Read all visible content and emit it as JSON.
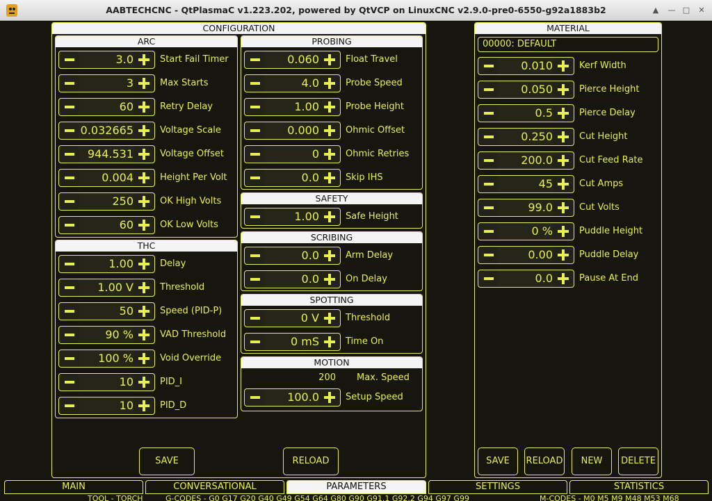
{
  "window": {
    "title": "AABTECHCNC - QtPlasmaC v1.223.202, powered by QtVCP on LinuxCNC v2.9.0-pre0-6550-g92a1883b2"
  },
  "window_buttons": {
    "up": "▲",
    "min": "—",
    "max": "□",
    "close": "✕"
  },
  "configuration": {
    "title": "CONFIGURATION",
    "arc": {
      "title": "ARC",
      "rows": [
        {
          "value": "3.0",
          "label": "Start Fail Timer"
        },
        {
          "value": "3",
          "label": "Max Starts"
        },
        {
          "value": "60",
          "label": "Retry Delay"
        },
        {
          "value": "0.032665",
          "label": "Voltage Scale"
        },
        {
          "value": "944.531",
          "label": "Voltage Offset"
        },
        {
          "value": "0.004",
          "label": "Height Per Volt"
        },
        {
          "value": "250",
          "label": "OK High Volts"
        },
        {
          "value": "60",
          "label": "OK Low Volts"
        }
      ]
    },
    "thc": {
      "title": "THC",
      "rows": [
        {
          "value": "1.00",
          "label": "Delay"
        },
        {
          "value": "1.00 V",
          "label": "Threshold"
        },
        {
          "value": "50",
          "label": "Speed (PID-P)"
        },
        {
          "value": "90 %",
          "label": "VAD Threshold"
        },
        {
          "value": "100 %",
          "label": "Void Override"
        },
        {
          "value": "10",
          "label": "PID_I"
        },
        {
          "value": "10",
          "label": "PID_D"
        }
      ]
    },
    "probing": {
      "title": "PROBING",
      "rows": [
        {
          "value": "0.060",
          "label": "Float Travel"
        },
        {
          "value": "4.0",
          "label": "Probe Speed"
        },
        {
          "value": "1.00",
          "label": "Probe Height"
        },
        {
          "value": "0.000",
          "label": "Ohmic Offset"
        },
        {
          "value": "0",
          "label": "Ohmic Retries"
        },
        {
          "value": "0.0",
          "label": "Skip IHS"
        }
      ]
    },
    "safety": {
      "title": "SAFETY",
      "rows": [
        {
          "value": "1.00",
          "label": "Safe Height"
        }
      ]
    },
    "scribing": {
      "title": "SCRIBING",
      "rows": [
        {
          "value": "0.0",
          "label": "Arm Delay"
        },
        {
          "value": "0.0",
          "label": "On Delay"
        }
      ]
    },
    "spotting": {
      "title": "SPOTTING",
      "rows": [
        {
          "value": "0 V",
          "label": "Threshold"
        },
        {
          "value": "0 mS",
          "label": "Time On"
        }
      ]
    },
    "motion": {
      "title": "MOTION",
      "max_speed_value": "200",
      "max_speed_label": "Max. Speed",
      "rows": [
        {
          "value": "100.0",
          "label": "Setup Speed"
        }
      ]
    },
    "save_label": "SAVE",
    "reload_label": "RELOAD"
  },
  "material": {
    "title": "MATERIAL",
    "selected": "00000: DEFAULT",
    "rows": [
      {
        "value": "0.010",
        "label": "Kerf Width"
      },
      {
        "value": "0.050",
        "label": "Pierce Height"
      },
      {
        "value": "0.5",
        "label": "Pierce Delay"
      },
      {
        "value": "0.250",
        "label": "Cut Height"
      },
      {
        "value": "200.0",
        "label": "Cut Feed Rate"
      },
      {
        "value": "45",
        "label": "Cut Amps"
      },
      {
        "value": "99.0",
        "label": "Cut Volts"
      },
      {
        "value": "0 %",
        "label": "Puddle Height"
      },
      {
        "value": "0.00",
        "label": "Puddle Delay"
      },
      {
        "value": "0.0",
        "label": "Pause At End"
      }
    ],
    "buttons": {
      "save": "SAVE",
      "reload": "RELOAD",
      "new": "NEW",
      "delete": "DELETE"
    }
  },
  "tabs": [
    {
      "label": "MAIN"
    },
    {
      "label": "CONVERSATIONAL"
    },
    {
      "label": "PARAMETERS"
    },
    {
      "label": "SETTINGS"
    },
    {
      "label": "STATISTICS"
    }
  ],
  "status": {
    "tool": "TOOL - TORCH",
    "gcodes": "G-CODES - G0 G17 G20 G40 G49 G54 G64 G80 G90 G91.1 G92.2 G94 G97 G99",
    "mcodes": "M-CODES - M0 M5 M9 M48 M53 M68"
  },
  "colors": {
    "accent": "#e8f050",
    "background": "#16160e",
    "header": "#f4f4f4"
  }
}
